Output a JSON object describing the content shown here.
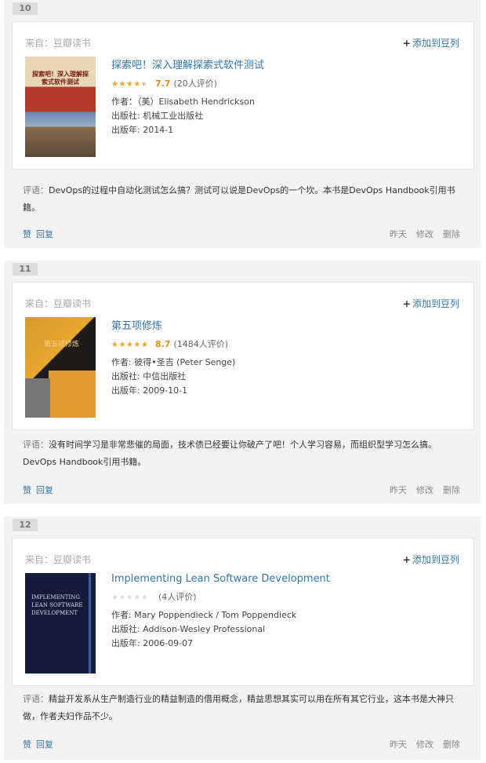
{
  "items": [
    {
      "index": "10",
      "source_label": "来自：",
      "source_name": "豆瓣读书",
      "add_label": "添加到豆列",
      "title": "探索吧！深入理解探索式软件测试",
      "cover_text": "探索吧！深入理解探索式软件测试",
      "rating": {
        "score": "7.7",
        "votes": "(20人评价)",
        "stars_fraction": 0.8
      },
      "author": "作者：（美）Elisabeth Hendrickson",
      "publisher": "出版社: 机械工业出版社",
      "year": "出版年: 2014-1",
      "comment_label": "评语：",
      "comment": "DevOps的过程中自动化测试怎么搞？测试可以说是DevOps的一个坎。本书是DevOps Handbook引用书籍。",
      "like": "赞",
      "reply": "回复",
      "time": "昨天",
      "edit": "修改",
      "delete": "删除"
    },
    {
      "index": "11",
      "source_label": "来自：",
      "source_name": "豆瓣读书",
      "add_label": "添加到豆列",
      "title": "第五项修炼",
      "cover_text": "第五项修炼",
      "rating": {
        "score": "8.7",
        "votes": "(1484人评价)",
        "stars_fraction": 0.9
      },
      "author": "作者: 彼得•圣吉 (Peter Senge)",
      "publisher": "出版社: 中信出版社",
      "year": "出版年: 2009-10-1",
      "comment_label": "评语：",
      "comment": "没有时间学习是非常悲催的局面，技术债已经要让你破产了吧！个人学习容易，而组织型学习怎么搞。DevOps Handbook引用书籍。",
      "like": "赞",
      "reply": "回复",
      "time": "昨天",
      "edit": "修改",
      "delete": "删除"
    },
    {
      "index": "12",
      "source_label": "来自：",
      "source_name": "豆瓣读书",
      "add_label": "添加到豆列",
      "title": "Implementing Lean Software Development",
      "cover_text": "IMPLEMENTING LEAN SOFTWARE DEVELOPMENT",
      "rating": {
        "score": "",
        "votes": "(4人评价)",
        "stars_fraction": 0
      },
      "author": "作者: Mary Poppendieck / Tom Poppendieck",
      "publisher": "出版社: Addison-Wesley Professional",
      "year": "出版年: 2006-09-07",
      "comment_label": "评语：",
      "comment": "精益开发系从生产制造行业的精益制造的借用概念，精益思想其实可以用在所有其它行业，这本书是大神只做，作者夫妇作品不少。",
      "like": "赞",
      "reply": "回复",
      "time": "昨天",
      "edit": "修改",
      "delete": "删除"
    }
  ],
  "colors": {
    "link": "#3377aa",
    "star": "#f5a623",
    "score": "#e09015",
    "panel": "#f3f3f3"
  }
}
